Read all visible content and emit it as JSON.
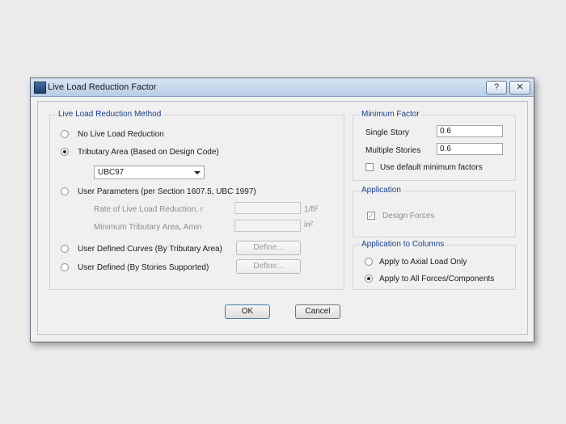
{
  "window": {
    "title": "Live Load Reduction Factor",
    "help_label": "?",
    "close_label": "✕"
  },
  "method_group": {
    "title": "Live Load Reduction Method",
    "options": [
      {
        "label": "No Live Load Reduction",
        "checked": false
      },
      {
        "label": "Tributary Area (Based on Design Code)",
        "checked": true
      },
      {
        "label": "User Parameters (per Section 1607.5, UBC 1997)",
        "checked": false
      },
      {
        "label": "User Defined Curves (By Tributary Area)",
        "checked": false
      },
      {
        "label": "User Defined (By Stories Supported)",
        "checked": false
      }
    ],
    "code_select": "UBC97",
    "rate_label": "Rate of Live Load Reduction, r",
    "rate_unit": "1/ft²",
    "min_area_label": "Minimum Tributary Area, Amin",
    "min_area_unit": "in²",
    "define_label": "Define..."
  },
  "min_factor_group": {
    "title": "Minimum Factor",
    "single_story_label": "Single Story",
    "single_story_value": "0.6",
    "multiple_stories_label": "Multiple Stories",
    "multiple_stories_value": "0.6",
    "use_default_label": "Use default minimum factors"
  },
  "application_group": {
    "title": "Application",
    "design_forces_label": "Design Forces"
  },
  "columns_group": {
    "title": "Application to Columns",
    "options": [
      {
        "label": "Apply to Axial Load Only",
        "checked": false
      },
      {
        "label": "Apply to All Forces/Components",
        "checked": true
      }
    ]
  },
  "buttons": {
    "ok": "OK",
    "cancel": "Cancel"
  }
}
